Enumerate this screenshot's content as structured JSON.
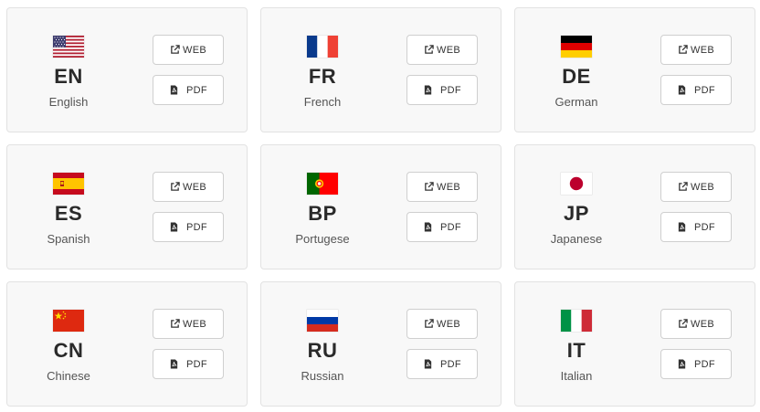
{
  "languages": [
    {
      "code": "EN",
      "name": "English",
      "flag": "us-flag",
      "web_label": "WEB",
      "pdf_label": "PDF"
    },
    {
      "code": "FR",
      "name": "French",
      "flag": "france-flag",
      "web_label": "WEB",
      "pdf_label": "PDF"
    },
    {
      "code": "DE",
      "name": "German",
      "flag": "germany-flag",
      "web_label": "WEB",
      "pdf_label": "PDF"
    },
    {
      "code": "ES",
      "name": "Spanish",
      "flag": "spain-flag",
      "web_label": "WEB",
      "pdf_label": "PDF"
    },
    {
      "code": "BP",
      "name": "Portugese",
      "flag": "portugal-flag",
      "web_label": "WEB",
      "pdf_label": "PDF"
    },
    {
      "code": "JP",
      "name": "Japanese",
      "flag": "japan-flag",
      "web_label": "WEB",
      "pdf_label": "PDF"
    },
    {
      "code": "CN",
      "name": "Chinese",
      "flag": "china-flag",
      "web_label": "WEB",
      "pdf_label": "PDF"
    },
    {
      "code": "RU",
      "name": "Russian",
      "flag": "russia-flag",
      "web_label": "WEB",
      "pdf_label": "PDF"
    },
    {
      "code": "IT",
      "name": "Italian",
      "flag": "italy-flag",
      "web_label": "WEB",
      "pdf_label": "PDF"
    }
  ],
  "icons": {
    "web": "external-link-icon",
    "pdf": "pdf-file-icon"
  },
  "colors": {
    "card_bg": "#f8f8f8",
    "card_border": "#e2e2e2",
    "text": "#2a2a2a",
    "subtext": "#555555"
  }
}
